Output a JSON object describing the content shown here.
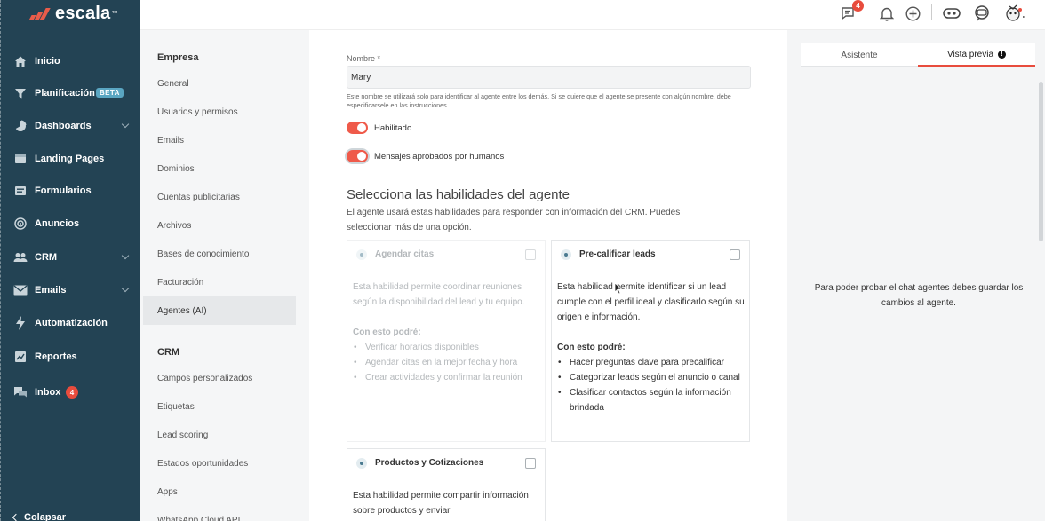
{
  "brand": {
    "name": "escala",
    "tm": "™",
    "accent": "#e85c4a",
    "nav_bg": "#234354"
  },
  "nav": {
    "items": [
      {
        "label": "Inicio",
        "icon": "home-icon"
      },
      {
        "label": "Planificación",
        "icon": "funnel-icon",
        "badge": "BETA"
      },
      {
        "label": "Dashboards",
        "icon": "pie-chart-icon",
        "chevron": true
      },
      {
        "label": "Landing Pages",
        "icon": "landing-page-icon"
      },
      {
        "label": "Formularios",
        "icon": "form-icon"
      },
      {
        "label": "Anuncios",
        "icon": "megaphone-icon"
      },
      {
        "label": "CRM",
        "icon": "users-icon",
        "chevron": true
      },
      {
        "label": "Emails",
        "icon": "mail-icon",
        "chevron": true
      },
      {
        "label": "Automatización",
        "icon": "bolt-icon"
      },
      {
        "label": "Reportes",
        "icon": "report-icon"
      },
      {
        "label": "Inbox",
        "icon": "chat-icon",
        "badge": "4"
      }
    ],
    "collapse_label": "Colapsar"
  },
  "settings_menu": {
    "sections": [
      {
        "title": "Empresa",
        "items": [
          "General",
          "Usuarios y permisos",
          "Emails",
          "Dominios",
          "Cuentas publicitarias",
          "Archivos",
          "Bases de conocimiento",
          "Facturación",
          "Agentes (AI)"
        ],
        "active": "Agentes (AI)"
      },
      {
        "title": "CRM",
        "items": [
          "Campos personalizados",
          "Etiquetas",
          "Lead scoring",
          "Estados oportunidades",
          "Apps",
          "WhatsApp Cloud API"
        ]
      }
    ]
  },
  "topbar": {
    "messages_badge": "4"
  },
  "form": {
    "name_label": "Nombre *",
    "name_value": "Mary",
    "name_help": "Este nombre se utilizará solo para identificar al agente entre los demás. Si se quiere que el agente se presente con algún nombre, debe especificarsele en las instrucciones.",
    "toggles": [
      {
        "label": "Habilitado",
        "on": true
      },
      {
        "label": "Mensajes aprobados por humanos",
        "on": true
      }
    ],
    "skills_title": "Selecciona las habilidades del agente",
    "skills_desc": "El agente usará estas habilidades para responder con información del CRM. Puedes seleccionar más de una opción.",
    "skills": [
      {
        "title": "Agendar citas",
        "desc": "Esta habilidad permite coordinar reuniones según la disponibilidad del lead y tu equipo.",
        "caption": "Con esto podré:",
        "bullets": [
          "Verificar horarios disponibles",
          "Agendar citas en la mejor fecha y hora",
          "Crear actividades y confirmar la reunión"
        ],
        "enabled": false,
        "checked": false
      },
      {
        "title": "Pre-calificar leads",
        "desc": "Esta habilidad permite identificar si un lead cumple con el perfil ideal y clasificarlo según su origen e información.",
        "caption": "Con esto podré:",
        "bullets": [
          "Hacer preguntas clave para precalificar",
          "Categorizar leads según el anuncio o canal",
          "Clasificar contactos según la información brindada"
        ],
        "enabled": true,
        "checked": false
      },
      {
        "title": "Productos y Cotizaciones",
        "desc": "Esta habilidad permite compartir información sobre productos y enviar",
        "enabled": true,
        "checked": false
      }
    ]
  },
  "preview": {
    "tabs": [
      "Asistente",
      "Vista previa"
    ],
    "active_tab": "Vista previa",
    "info_glyph": "!",
    "message": "Para poder probar el chat agentes debes guardar los cambios al agente."
  }
}
